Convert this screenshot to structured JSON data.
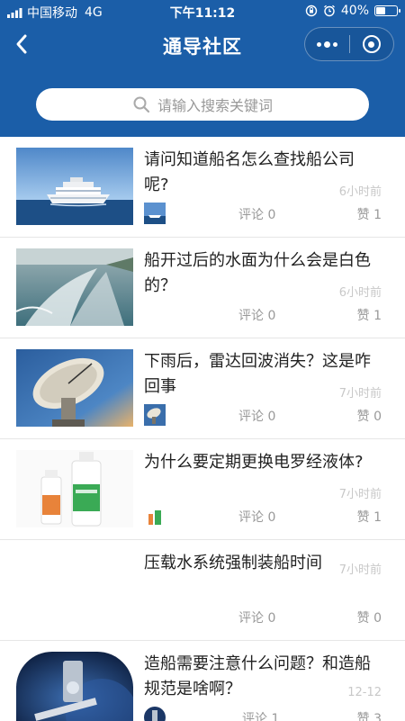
{
  "status_bar": {
    "carrier": "中国移动",
    "network": "4G",
    "time": "下午11:12",
    "battery_text": "40%",
    "battery_level": 0.4
  },
  "header": {
    "back_icon": "chevron-left-icon",
    "title": "通导社区",
    "more_icon": "more-dots-icon",
    "close_icon": "target-circle-icon"
  },
  "search": {
    "icon": "search-icon",
    "placeholder": "请输入搜索关键词"
  },
  "posts": [
    {
      "title": "请问知道船名怎么查找船公司呢?",
      "time": "6小时前",
      "comments": "评论 0",
      "likes": "赞 1",
      "image": "cruise-ship"
    },
    {
      "title": "船开过后的水面为什么会是白色的？",
      "time": "6小时前",
      "comments": "评论 0",
      "likes": "赞 1",
      "image": "ship-wake"
    },
    {
      "title": "下雨后，雷达回波消失？这是咋回事",
      "time": "7小时前",
      "comments": "评论 0",
      "likes": "赞 0",
      "image": "radar-dish"
    },
    {
      "title": "为什么要定期更换电罗经液体?",
      "time": "7小时前",
      "comments": "评论 0",
      "likes": "赞 1",
      "image": "liquid-bottles"
    },
    {
      "title": "压载水系统强制装船时间",
      "time": "7小时前",
      "comments": "评论 0",
      "likes": "赞 0",
      "image": ""
    },
    {
      "title": "造船需要注意什么问题？和造船规范是啥啊？",
      "time": "12-12",
      "comments": "评论 1",
      "likes": "赞 3",
      "image": "space-equipment"
    }
  ],
  "colors": {
    "header_bg": "#1b5ea8",
    "text_primary": "#222222",
    "text_secondary": "#999999",
    "time_text": "#c8c8c8"
  }
}
